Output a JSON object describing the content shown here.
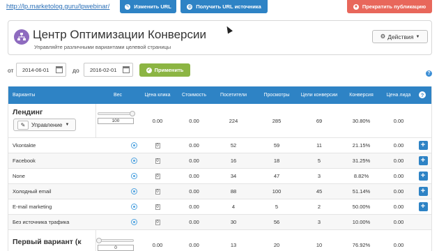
{
  "topbar": {
    "url": "http://lp.marketolog.guru/lpwebinar/",
    "change_url_label": "Изменить URL",
    "get_source_url_label": "Получить URL источника",
    "stop_publish_label": "Прекратить публикацию"
  },
  "header": {
    "title": "Центр Оптимизации Конверсии",
    "subtitle": "Управляйте различными вариантами целевой страницы",
    "actions_label": "Действия"
  },
  "filter": {
    "from_label": "от",
    "from_value": "2014-06-01",
    "to_label": "до",
    "to_value": "2016-02-01",
    "apply_label": "Применить"
  },
  "colors": {
    "primary": "#2e83c5",
    "danger": "#e8675b",
    "success": "#8cb543",
    "logo": "#8e6bbf"
  },
  "table": {
    "columns": [
      "Варианты",
      "Вес",
      "Цена клика",
      "Стоимость",
      "Посетители",
      "Просмотры",
      "Цели конверсии",
      "Конверсия",
      "Цена лида",
      "?"
    ],
    "groups": [
      {
        "title": "Лендинг",
        "manage_label": "Управление",
        "weight": "100",
        "weight_fraction": 1.0,
        "cpc": "0.00",
        "cost": "0.00",
        "visitors": "224",
        "views": "285",
        "goals": "69",
        "conversion": "30.80%",
        "lead_price": "0.00"
      },
      {
        "title": "Первый вариант (к",
        "manage_label": "",
        "weight": "0",
        "weight_fraction": 0.0,
        "cpc": "0.00",
        "cost": "0.00",
        "visitors": "13",
        "views": "20",
        "goals": "10",
        "conversion": "76.92%",
        "lead_price": "0.00"
      }
    ],
    "sources": [
      {
        "name": "Vkontakte",
        "weight": "0",
        "cost": "0.00",
        "visitors": "52",
        "views": "59",
        "goals": "11",
        "conversion": "21.15%",
        "lead_price": "0.00"
      },
      {
        "name": "Facebook",
        "weight": "0",
        "cost": "0.00",
        "visitors": "16",
        "views": "18",
        "goals": "5",
        "conversion": "31.25%",
        "lead_price": "0.00"
      },
      {
        "name": "None",
        "weight": "0",
        "cost": "0.00",
        "visitors": "34",
        "views": "47",
        "goals": "3",
        "conversion": "8.82%",
        "lead_price": "0.00"
      },
      {
        "name": "Холодный email",
        "weight": "0",
        "cost": "0.00",
        "visitors": "88",
        "views": "100",
        "goals": "45",
        "conversion": "51.14%",
        "lead_price": "0.00"
      },
      {
        "name": "E-mail marketing",
        "weight": "0",
        "cost": "0.00",
        "visitors": "4",
        "views": "5",
        "goals": "2",
        "conversion": "50.00%",
        "lead_price": "0.00"
      },
      {
        "name": "Без источника трафика",
        "weight": "0",
        "cost": "0.00",
        "visitors": "30",
        "views": "56",
        "goals": "3",
        "conversion": "10.00%",
        "lead_price": "0.00"
      }
    ]
  }
}
